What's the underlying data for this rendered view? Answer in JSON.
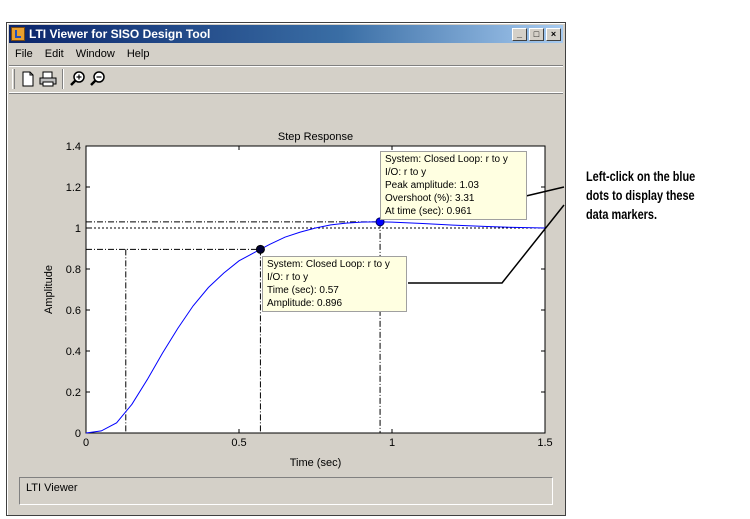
{
  "window": {
    "title": "LTI Viewer for SISO Design Tool",
    "buttons": {
      "minimize": "_",
      "maximize": "□",
      "close": "×"
    }
  },
  "menu": [
    "File",
    "Edit",
    "Window",
    "Help"
  ],
  "toolbar": {
    "icons": [
      "new-file-icon",
      "print-icon",
      "zoom-in-icon",
      "zoom-out-icon"
    ]
  },
  "status": "LTI Viewer",
  "callout": {
    "lines": [
      "Left-click on the blue",
      "dots to display these",
      "data markers."
    ]
  },
  "colors": {
    "curve": "#0000ff",
    "marker_blue": "#0000ff",
    "marker_dark": "#000033",
    "tip_bg": "#ffffe1"
  },
  "chart_data": {
    "type": "line",
    "title": "Step Response",
    "xlabel": "Time (sec)",
    "ylabel": "Amplitude",
    "xlim": [
      0,
      1.5
    ],
    "ylim": [
      0,
      1.4
    ],
    "xticks": [
      0,
      0.5,
      1,
      1.5
    ],
    "xtick_labels": [
      "0",
      "0.5",
      "1",
      "1.5"
    ],
    "yticks": [
      0,
      0.2,
      0.4,
      0.6,
      0.8,
      1,
      1.2,
      1.4
    ],
    "ytick_labels": [
      "0",
      "0.2",
      "0.4",
      "0.6",
      "0.8",
      "1",
      "1.2",
      "1.4"
    ],
    "grid": false,
    "series": [
      {
        "x": [
          0,
          0.05,
          0.1,
          0.15,
          0.2,
          0.25,
          0.3,
          0.35,
          0.4,
          0.45,
          0.5,
          0.55,
          0.57,
          0.6,
          0.65,
          0.7,
          0.75,
          0.8,
          0.85,
          0.9,
          0.961,
          1.0,
          1.1,
          1.2,
          1.3,
          1.4,
          1.5
        ],
        "y": [
          0,
          0.01,
          0.05,
          0.14,
          0.26,
          0.39,
          0.51,
          0.62,
          0.71,
          0.78,
          0.84,
          0.88,
          0.896,
          0.92,
          0.955,
          0.98,
          1.0,
          1.015,
          1.024,
          1.029,
          1.03,
          1.029,
          1.022,
          1.014,
          1.008,
          1.003,
          1.0
        ]
      }
    ],
    "reference_lines": {
      "final_value": 1.0,
      "rise_time_markers": [
        0.13,
        0.57
      ],
      "peak": {
        "x": 0.961,
        "y": 1.03
      },
      "point": {
        "x": 0.57,
        "y": 0.896
      }
    },
    "datatips": [
      {
        "name": "peak",
        "lines": [
          "System: Closed Loop: r to y",
          "I/O: r to y",
          "Peak amplitude: 1.03",
          "Overshoot (%): 3.31",
          "At time (sec): 0.961"
        ]
      },
      {
        "name": "point",
        "lines": [
          "System: Closed Loop: r to y",
          "I/O: r to y",
          "Time (sec): 0.57",
          "Amplitude: 0.896"
        ]
      }
    ]
  }
}
